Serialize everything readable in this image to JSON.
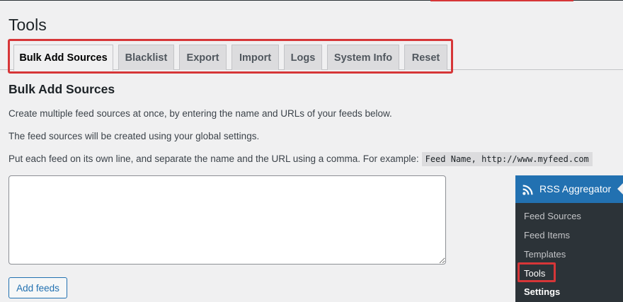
{
  "page": {
    "title": "Tools"
  },
  "tabs": [
    {
      "label": "Bulk Add Sources",
      "active": true
    },
    {
      "label": "Blacklist",
      "active": false
    },
    {
      "label": "Export",
      "active": false
    },
    {
      "label": "Import",
      "active": false
    },
    {
      "label": "Logs",
      "active": false
    },
    {
      "label": "System Info",
      "active": false
    },
    {
      "label": "Reset",
      "active": false
    }
  ],
  "section": {
    "title": "Bulk Add Sources",
    "paragraphs": [
      "Create multiple feed sources at once, by entering the name and URLs of your feeds below.",
      "The feed sources will be created using your global settings.",
      "Put each feed on its own line, and separate the name and the URL using a comma. For example:"
    ],
    "example_code": "Feed Name, http://www.myfeed.com"
  },
  "form": {
    "textarea_value": "",
    "submit_label": "Add feeds"
  },
  "admin_menu": {
    "title": "RSS Aggregator",
    "icon": "rss-icon",
    "items": [
      {
        "label": "Feed Sources"
      },
      {
        "label": "Feed Items"
      },
      {
        "label": "Templates"
      },
      {
        "label": "Tools"
      },
      {
        "label": "Settings"
      }
    ]
  },
  "colors": {
    "background": "#f0f0f1",
    "accent": "#2271b1",
    "highlight": "#d63638",
    "menu_bg": "#2c3338"
  }
}
